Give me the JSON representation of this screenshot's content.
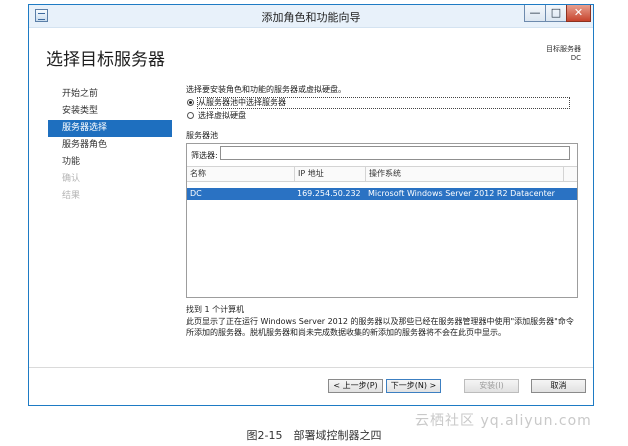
{
  "window": {
    "title": "添加角色和功能向导",
    "controls": {
      "minimize": "—",
      "maximize": "□",
      "close": "✕"
    }
  },
  "header": {
    "page_title": "选择目标服务器",
    "destination_label": "目标服务器",
    "destination_value": "DC"
  },
  "nav": {
    "items": [
      {
        "label": "开始之前",
        "state": "normal"
      },
      {
        "label": "安装类型",
        "state": "normal"
      },
      {
        "label": "服务器选择",
        "state": "selected"
      },
      {
        "label": "服务器角色",
        "state": "normal"
      },
      {
        "label": "功能",
        "state": "normal"
      },
      {
        "label": "确认",
        "state": "disabled"
      },
      {
        "label": "结果",
        "state": "disabled"
      }
    ]
  },
  "content": {
    "instruction": "选择要安装角色和功能的服务器或虚拟硬盘。",
    "options": [
      {
        "label": "从服务器池中选择服务器",
        "checked": true
      },
      {
        "label": "选择虚拟硬盘",
        "checked": false
      }
    ],
    "pool_label": "服务器池",
    "filter_label": "筛选器:",
    "filter_value": "",
    "columns": [
      "名称",
      "IP 地址",
      "操作系统"
    ],
    "rows": [
      {
        "name": "DC",
        "ip": "169.254.50.232",
        "os": "Microsoft Windows Server 2012 R2 Datacenter"
      }
    ],
    "found_text": "找到 1 个计算机",
    "info_text": "此页显示了正在运行 Windows Server 2012 的服务器以及那些已经在服务器管理器中使用\"添加服务器\"命令所添加的服务器。脱机服务器和尚未完成数据收集的新添加的服务器将不会在此页中显示。"
  },
  "buttons": {
    "prev": "< 上一步(P)",
    "next": "下一步(N) >",
    "install": "安装(I)",
    "cancel": "取消"
  },
  "caption": "图2-15　部署域控制器之四",
  "watermark": "云栖社区 yq.aliyun.com",
  "colors": {
    "accent": "#1e6fbf",
    "selected_row": "#2a72c3",
    "close_button": "#c7442d"
  }
}
